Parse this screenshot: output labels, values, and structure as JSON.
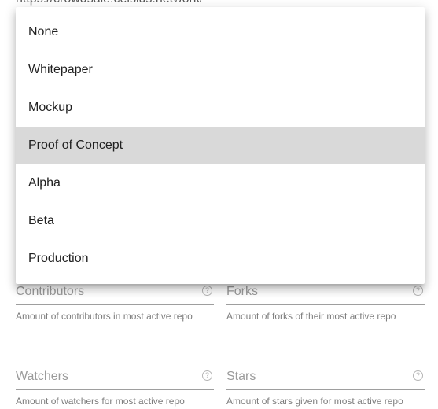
{
  "url_field": {
    "value": "https://crowdsale.celsius.network/"
  },
  "stage_menu": {
    "options": [
      "None",
      "Whitepaper",
      "Mockup",
      "Proof of Concept",
      "Alpha",
      "Beta",
      "Production"
    ],
    "highlighted": "Proof of Concept"
  },
  "fields": {
    "contributors": {
      "label": "Contributors",
      "helper": "Amount of contributors in most active repo"
    },
    "forks": {
      "label": "Forks",
      "helper": "Amount of forks of their most active repo"
    },
    "watchers": {
      "label": "Watchers",
      "helper": "Amount of watchers for most active repo"
    },
    "stars": {
      "label": "Stars",
      "helper": "Amount of stars given for most active repo"
    }
  },
  "help_glyph": "?",
  "colors": {
    "highlight": "#d9d9d9",
    "underline": "#9e9e9e"
  }
}
